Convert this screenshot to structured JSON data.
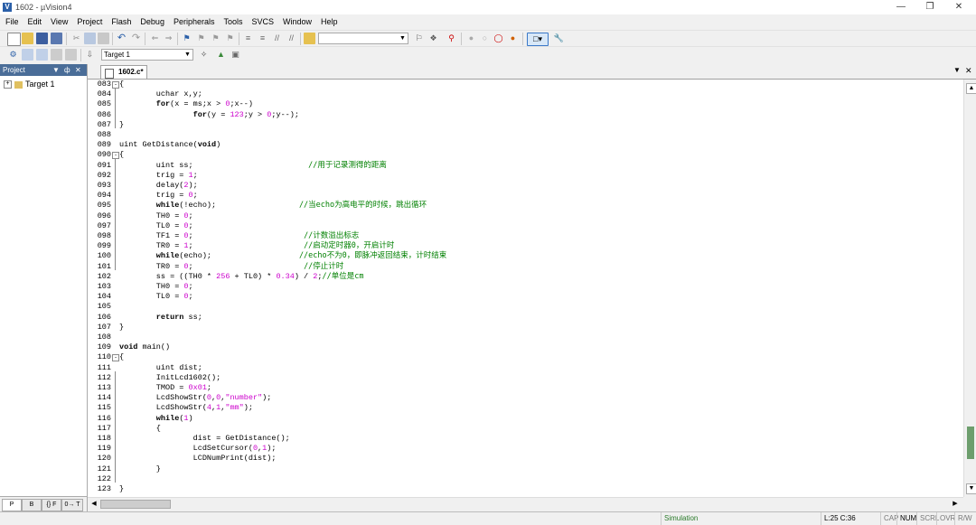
{
  "window": {
    "title": "1602 - µVision4",
    "app_icon": "uvision-icon"
  },
  "menubar": {
    "items": [
      "File",
      "Edit",
      "View",
      "Project",
      "Flash",
      "Debug",
      "Peripherals",
      "Tools",
      "SVCS",
      "Window",
      "Help"
    ]
  },
  "toolbar2": {
    "target_value": "Target 1"
  },
  "project_panel": {
    "title": "Project",
    "tree_root": "Target 1",
    "tabs": [
      "P",
      "B",
      "{} F",
      "0→ T"
    ]
  },
  "editor": {
    "active_tab": "1602.c*",
    "lines": [
      {
        "n": "083",
        "fold": "-",
        "code": [
          [
            "p",
            "{"
          ]
        ]
      },
      {
        "n": "084",
        "code": [
          [
            "p",
            "        uchar x,y;"
          ]
        ]
      },
      {
        "n": "085",
        "code": [
          [
            "k",
            "        for"
          ],
          [
            "p",
            "(x = ms;x > "
          ],
          [
            "n",
            "0"
          ],
          [
            "p",
            ";x--)"
          ]
        ]
      },
      {
        "n": "086",
        "code": [
          [
            "k",
            "                for"
          ],
          [
            "p",
            "(y = "
          ],
          [
            "n",
            "123"
          ],
          [
            "p",
            ";y > "
          ],
          [
            "n",
            "0"
          ],
          [
            "p",
            ";y--);"
          ]
        ]
      },
      {
        "n": "087",
        "code": [
          [
            "p",
            "}"
          ]
        ]
      },
      {
        "n": "088",
        "code": [
          [
            "p",
            ""
          ]
        ]
      },
      {
        "n": "089",
        "code": [
          [
            "p",
            "uint GetDistance("
          ],
          [
            "k",
            "void"
          ],
          [
            "p",
            ")"
          ]
        ]
      },
      {
        "n": "090",
        "fold": "-",
        "code": [
          [
            "p",
            "{"
          ]
        ]
      },
      {
        "n": "091",
        "code": [
          [
            "p",
            "        uint ss;                         "
          ],
          [
            "c",
            "//用于记录测得的距离"
          ]
        ]
      },
      {
        "n": "092",
        "code": [
          [
            "p",
            "        trig = "
          ],
          [
            "n",
            "1"
          ],
          [
            "p",
            ";"
          ]
        ]
      },
      {
        "n": "093",
        "code": [
          [
            "p",
            "        delay("
          ],
          [
            "n",
            "2"
          ],
          [
            "p",
            ");"
          ]
        ]
      },
      {
        "n": "094",
        "code": [
          [
            "p",
            "        trig = "
          ],
          [
            "n",
            "0"
          ],
          [
            "p",
            ";"
          ]
        ]
      },
      {
        "n": "095",
        "code": [
          [
            "k",
            "        while"
          ],
          [
            "p",
            "(!echo);                  "
          ],
          [
            "c",
            "//当echo为高电平的时候，跳出循环"
          ]
        ]
      },
      {
        "n": "096",
        "code": [
          [
            "p",
            "        TH0 = "
          ],
          [
            "n",
            "0"
          ],
          [
            "p",
            ";"
          ]
        ]
      },
      {
        "n": "097",
        "code": [
          [
            "p",
            "        TL0 = "
          ],
          [
            "n",
            "0"
          ],
          [
            "p",
            ";"
          ]
        ]
      },
      {
        "n": "098",
        "code": [
          [
            "p",
            "        TF1 = "
          ],
          [
            "n",
            "0"
          ],
          [
            "p",
            ";                        "
          ],
          [
            "c",
            "//计数溢出标志"
          ]
        ]
      },
      {
        "n": "099",
        "code": [
          [
            "p",
            "        TR0 = "
          ],
          [
            "n",
            "1"
          ],
          [
            "p",
            ";                        "
          ],
          [
            "c",
            "//启动定时器0，开启计时"
          ]
        ]
      },
      {
        "n": "100",
        "code": [
          [
            "k",
            "        while"
          ],
          [
            "p",
            "(echo);                   "
          ],
          [
            "c",
            "//echo不为0，即脉冲返回结束，计时结束"
          ]
        ]
      },
      {
        "n": "101",
        "code": [
          [
            "p",
            "        TR0 = "
          ],
          [
            "n",
            "0"
          ],
          [
            "p",
            ";                        "
          ],
          [
            "c",
            "//停止计时"
          ]
        ]
      },
      {
        "n": "102",
        "code": [
          [
            "p",
            "        ss = ((TH0 * "
          ],
          [
            "n",
            "256"
          ],
          [
            "p",
            " + TL0) * "
          ],
          [
            "n",
            "0.34"
          ],
          [
            "p",
            ") / "
          ],
          [
            "n",
            "2"
          ],
          [
            "p",
            ";"
          ],
          [
            "c",
            "//单位是cm"
          ]
        ]
      },
      {
        "n": "103",
        "code": [
          [
            "p",
            "        TH0 = "
          ],
          [
            "n",
            "0"
          ],
          [
            "p",
            ";"
          ]
        ]
      },
      {
        "n": "104",
        "code": [
          [
            "p",
            "        TL0 = "
          ],
          [
            "n",
            "0"
          ],
          [
            "p",
            ";"
          ]
        ]
      },
      {
        "n": "105",
        "code": [
          [
            "p",
            ""
          ]
        ]
      },
      {
        "n": "106",
        "code": [
          [
            "k",
            "        return"
          ],
          [
            "p",
            " ss;"
          ]
        ]
      },
      {
        "n": "107",
        "code": [
          [
            "p",
            "}"
          ]
        ]
      },
      {
        "n": "108",
        "code": [
          [
            "p",
            ""
          ]
        ]
      },
      {
        "n": "109",
        "code": [
          [
            "k",
            "void"
          ],
          [
            "p",
            " main()"
          ]
        ]
      },
      {
        "n": "110",
        "fold": "-",
        "code": [
          [
            "p",
            "{"
          ]
        ]
      },
      {
        "n": "111",
        "code": [
          [
            "p",
            "        uint dist;"
          ]
        ]
      },
      {
        "n": "112",
        "code": [
          [
            "p",
            "        InitLcd1602();"
          ]
        ]
      },
      {
        "n": "113",
        "code": [
          [
            "p",
            "        TMOD = "
          ],
          [
            "n",
            "0x01"
          ],
          [
            "p",
            ";"
          ]
        ]
      },
      {
        "n": "114",
        "code": [
          [
            "p",
            "        LcdShowStr("
          ],
          [
            "n",
            "0"
          ],
          [
            "p",
            ","
          ],
          [
            "n",
            "0"
          ],
          [
            "p",
            ","
          ],
          [
            "s",
            "\"number\""
          ],
          [
            "p",
            ");"
          ]
        ]
      },
      {
        "n": "115",
        "code": [
          [
            "p",
            "        LcdShowStr("
          ],
          [
            "n",
            "4"
          ],
          [
            "p",
            ","
          ],
          [
            "n",
            "1"
          ],
          [
            "p",
            ","
          ],
          [
            "s",
            "\"mm\""
          ],
          [
            "p",
            ");"
          ]
        ]
      },
      {
        "n": "116",
        "code": [
          [
            "k",
            "        while"
          ],
          [
            "p",
            "("
          ],
          [
            "n",
            "1"
          ],
          [
            "p",
            ")"
          ]
        ]
      },
      {
        "n": "117",
        "code": [
          [
            "p",
            "        {"
          ]
        ]
      },
      {
        "n": "118",
        "code": [
          [
            "p",
            "                dist = GetDistance();"
          ]
        ]
      },
      {
        "n": "119",
        "code": [
          [
            "p",
            "                LcdSetCursor("
          ],
          [
            "n",
            "0"
          ],
          [
            "p",
            ","
          ],
          [
            "n",
            "1"
          ],
          [
            "p",
            ");"
          ]
        ]
      },
      {
        "n": "120",
        "code": [
          [
            "p",
            "                LCDNumPrint(dist);"
          ]
        ]
      },
      {
        "n": "121",
        "code": [
          [
            "p",
            "        }"
          ]
        ]
      },
      {
        "n": "122",
        "code": [
          [
            "p",
            ""
          ]
        ]
      },
      {
        "n": "123",
        "code": [
          [
            "p",
            "}"
          ]
        ]
      }
    ]
  },
  "statusbar": {
    "mode": "Simulation",
    "position": "L:25 C:36",
    "cap": "CAP",
    "num": "NUM",
    "scrl": "SCRL",
    "ovr": "OVR",
    "rw": "R/W"
  },
  "colors": {
    "keyword": "#000000",
    "number": "#cc00cc",
    "comment": "#008000",
    "panel_header": "#4a6d98",
    "scroll_thumb": "#6d9e6d"
  }
}
